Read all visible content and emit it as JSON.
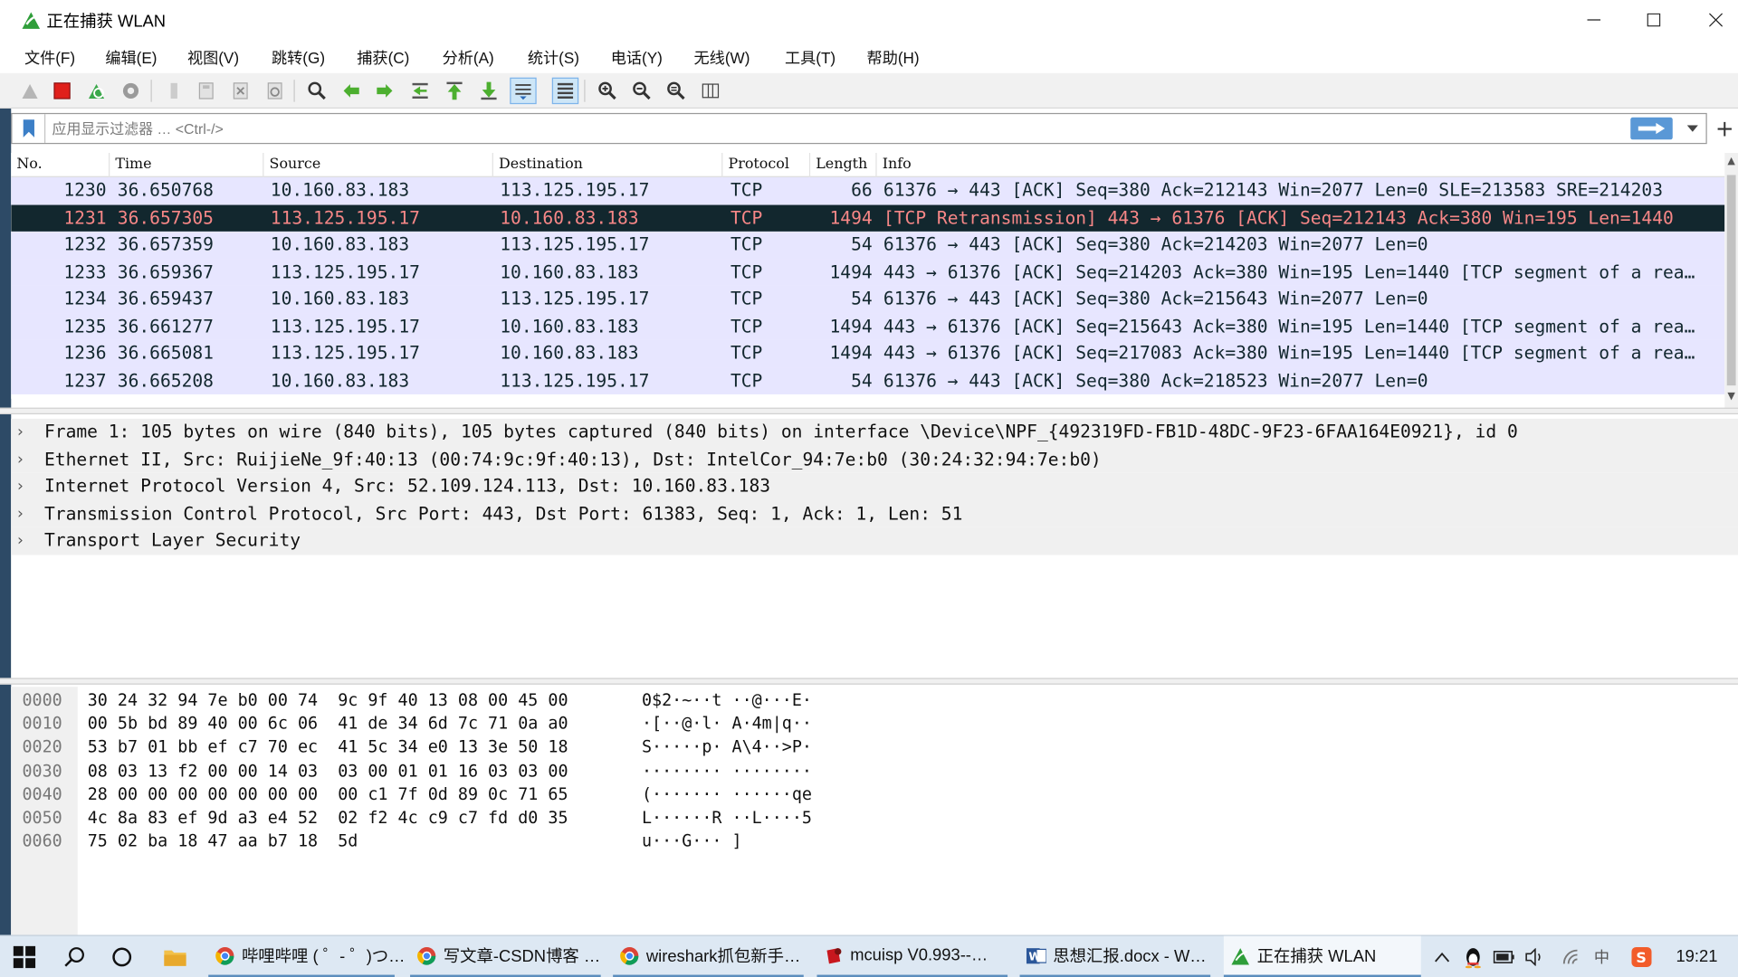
{
  "window": {
    "title": "正在捕获 WLAN",
    "colors": {
      "selected_row_bg": "#12272e",
      "selected_row_fg": "#f78787",
      "tcp_row_bg": "#e7e6ff",
      "detail_bg": "#f0f0f0"
    }
  },
  "menu": [
    "文件(F)",
    "编辑(E)",
    "视图(V)",
    "跳转(G)",
    "捕获(C)",
    "分析(A)",
    "统计(S)",
    "电话(Y)",
    "无线(W)",
    "工具(T)",
    "帮助(H)"
  ],
  "toolbar": {
    "icons": [
      "shark-fin-start-icon",
      "stop-capture-icon",
      "restart-capture-icon",
      "capture-options-icon",
      "open-file-icon",
      "save-file-icon",
      "close-file-icon",
      "reload-file-icon",
      "find-packet-icon",
      "go-back-icon",
      "go-forward-icon",
      "go-to-packet-icon",
      "go-first-icon",
      "go-last-icon",
      "autoscroll-icon",
      "colorize-icon",
      "zoom-in-icon",
      "zoom-out-icon",
      "zoom-reset-icon",
      "resize-columns-icon"
    ]
  },
  "filter": {
    "placeholder": "应用显示过滤器 … <Ctrl-/>",
    "value": ""
  },
  "packet_list": {
    "columns": [
      "No.",
      "Time",
      "Source",
      "Destination",
      "Protocol",
      "Length",
      "Info"
    ],
    "rows": [
      {
        "no": "1230",
        "time": "36.650768",
        "src": "10.160.83.183",
        "dst": "113.125.195.17",
        "proto": "TCP",
        "len": "66",
        "info": "61376 → 443 [ACK] Seq=380 Ack=212143 Win=2077 Len=0 SLE=213583 SRE=214203",
        "selected": false
      },
      {
        "no": "1231",
        "time": "36.657305",
        "src": "113.125.195.17",
        "dst": "10.160.83.183",
        "proto": "TCP",
        "len": "1494",
        "info": "[TCP Retransmission] 443 → 61376 [ACK] Seq=212143 Ack=380 Win=195 Len=1440",
        "selected": true
      },
      {
        "no": "1232",
        "time": "36.657359",
        "src": "10.160.83.183",
        "dst": "113.125.195.17",
        "proto": "TCP",
        "len": "54",
        "info": "61376 → 443 [ACK] Seq=380 Ack=214203 Win=2077 Len=0",
        "selected": false
      },
      {
        "no": "1233",
        "time": "36.659367",
        "src": "113.125.195.17",
        "dst": "10.160.83.183",
        "proto": "TCP",
        "len": "1494",
        "info": "443 → 61376 [ACK] Seq=214203 Ack=380 Win=195 Len=1440 [TCP segment of a rea…",
        "selected": false
      },
      {
        "no": "1234",
        "time": "36.659437",
        "src": "10.160.83.183",
        "dst": "113.125.195.17",
        "proto": "TCP",
        "len": "54",
        "info": "61376 → 443 [ACK] Seq=380 Ack=215643 Win=2077 Len=0",
        "selected": false
      },
      {
        "no": "1235",
        "time": "36.661277",
        "src": "113.125.195.17",
        "dst": "10.160.83.183",
        "proto": "TCP",
        "len": "1494",
        "info": "443 → 61376 [ACK] Seq=215643 Ack=380 Win=195 Len=1440 [TCP segment of a rea…",
        "selected": false
      },
      {
        "no": "1236",
        "time": "36.665081",
        "src": "113.125.195.17",
        "dst": "10.160.83.183",
        "proto": "TCP",
        "len": "1494",
        "info": "443 → 61376 [ACK] Seq=217083 Ack=380 Win=195 Len=1440 [TCP segment of a rea…",
        "selected": false
      },
      {
        "no": "1237",
        "time": "36.665208",
        "src": "10.160.83.183",
        "dst": "113.125.195.17",
        "proto": "TCP",
        "len": "54",
        "info": "61376 → 443 [ACK] Seq=380 Ack=218523 Win=2077 Len=0",
        "selected": false
      }
    ]
  },
  "details": [
    "Frame 1: 105 bytes on wire (840 bits), 105 bytes captured (840 bits) on interface \\Device\\NPF_{492319FD-FB1D-48DC-9F23-6FAA164E0921}, id 0",
    "Ethernet II, Src: RuijieNe_9f:40:13 (00:74:9c:9f:40:13), Dst: IntelCor_94:7e:b0 (30:24:32:94:7e:b0)",
    "Internet Protocol Version 4, Src: 52.109.124.113, Dst: 10.160.83.183",
    "Transmission Control Protocol, Src Port: 443, Dst Port: 61383, Seq: 1, Ack: 1, Len: 51",
    "Transport Layer Security"
  ],
  "bytes": [
    {
      "off": "0000",
      "hex": "30 24 32 94 7e b0 00 74  9c 9f 40 13 08 00 45 00",
      "ascii": "0$2·~··t ··@···E·"
    },
    {
      "off": "0010",
      "hex": "00 5b bd 89 40 00 6c 06  41 de 34 6d 7c 71 0a a0",
      "ascii": "·[··@·l· A·4m|q··"
    },
    {
      "off": "0020",
      "hex": "53 b7 01 bb ef c7 70 ec  41 5c 34 e0 13 3e 50 18",
      "ascii": "S·····p· A\\4··>P·"
    },
    {
      "off": "0030",
      "hex": "08 03 13 f2 00 00 14 03  03 00 01 01 16 03 03 00",
      "ascii": "········ ········"
    },
    {
      "off": "0040",
      "hex": "28 00 00 00 00 00 00 00  00 c1 7f 0d 89 0c 71 65",
      "ascii": "(······· ······qe"
    },
    {
      "off": "0050",
      "hex": "4c 8a 83 ef 9d a3 e4 52  02 f2 4c c9 c7 fd d0 35",
      "ascii": "L······R ··L····5"
    },
    {
      "off": "0060",
      "hex": "75 02 ba 18 47 aa b7 18  5d",
      "ascii": "u···G··· ]"
    }
  ],
  "taskbar": {
    "apps": [
      {
        "label": "哔哩哔哩 ( ゜- ゜)つ…",
        "icon": "chrome-icon"
      },
      {
        "label": "写文章-CSDN博客 …",
        "icon": "chrome-icon"
      },
      {
        "label": "wireshark抓包新手…",
        "icon": "chrome-icon"
      },
      {
        "label": "mcuisp V0.993--…",
        "icon": "mcuisp-icon"
      },
      {
        "label": "思想汇报.docx - W…",
        "icon": "word-icon"
      },
      {
        "label": "正在捕获 WLAN",
        "icon": "wireshark-icon"
      }
    ],
    "ime": "中",
    "clock": "19:21"
  }
}
